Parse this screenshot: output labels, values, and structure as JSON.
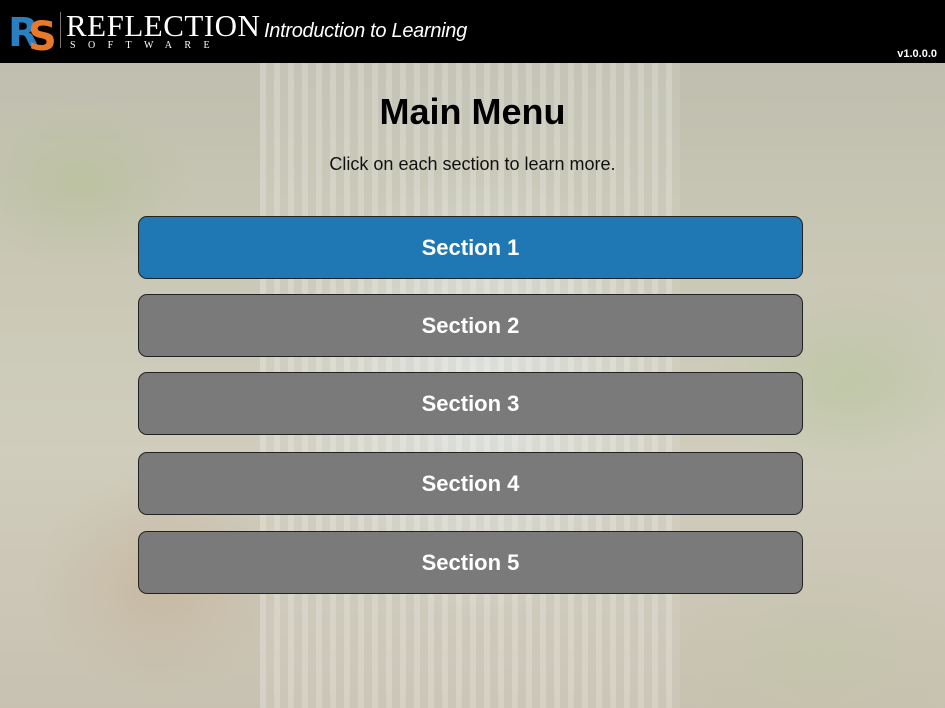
{
  "header": {
    "brand_name": "REFLECTION",
    "brand_sub": "SOFTWARE",
    "app_title": "Introduction to Learning",
    "version": "v1.0.0.0",
    "logo_colors": {
      "r": "#2a7fc0",
      "s": "#e8792b"
    }
  },
  "main": {
    "title": "Main Menu",
    "subtitle": "Click on each section to learn more.",
    "sections": [
      {
        "label": "Section 1",
        "state": "active"
      },
      {
        "label": "Section 2",
        "state": "default"
      },
      {
        "label": "Section 3",
        "state": "default"
      },
      {
        "label": "Section 4",
        "state": "default"
      },
      {
        "label": "Section 5",
        "state": "default"
      }
    ]
  },
  "colors": {
    "active_button": "#1f78b4",
    "default_button": "#7a7a7a",
    "header_bg": "#000000"
  }
}
